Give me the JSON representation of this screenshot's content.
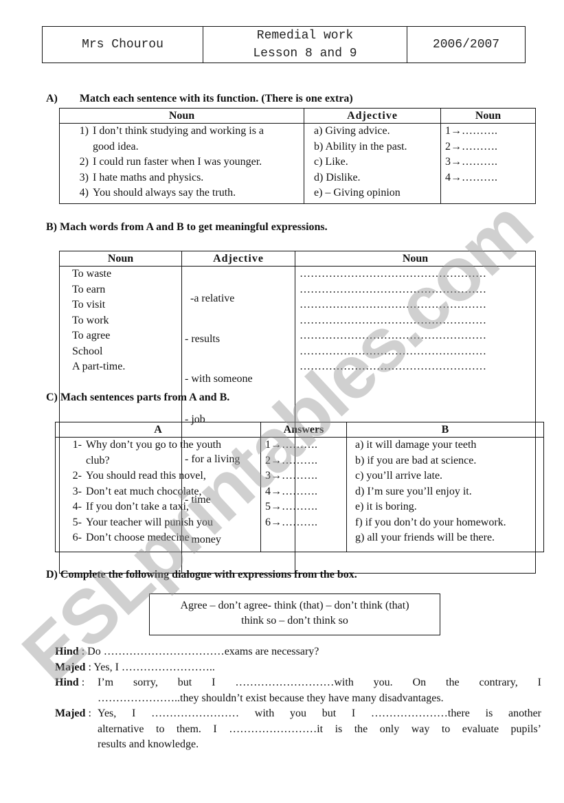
{
  "header": {
    "teacher": "Mrs Chourou",
    "title_line1": "Remedial work",
    "title_line2": "Lesson 8 and 9",
    "year": "2006/2007"
  },
  "watermark": "ESLprintables.com",
  "sectionA": {
    "label": "A)",
    "title": "Match each sentence with its function. (There is one extra)",
    "headers": [
      "Noun",
      "Adjective",
      "Noun"
    ],
    "sentences": [
      {
        "num": "1)",
        "line1": "I don’t think studying and working is a",
        "line2": "good idea."
      },
      {
        "num": "2)",
        "line1": "I could run faster when I was younger."
      },
      {
        "num": "3)",
        "line1": "I hate maths and physics."
      },
      {
        "num": "4)",
        "line1": "You should always say the truth."
      }
    ],
    "functions": [
      "a) Giving advice.",
      "b) Ability in the past.",
      "c) Like.",
      "d) Dislike.",
      "e) – Giving opinion"
    ],
    "answers": [
      "1→……….",
      "2→……….",
      "3→……….",
      "4→………."
    ]
  },
  "sectionB": {
    "title": "B) Mach words from A and B to get meaningful expressions.",
    "headers": [
      "Noun",
      "Adjective",
      "Noun"
    ],
    "colA": [
      "To waste",
      "To earn",
      "To visit",
      "To work",
      "To agree",
      "School",
      "A part-time."
    ],
    "colB": [
      "  -a relative",
      "- results",
      "- with someone",
      "- job",
      "- for a living",
      "- time",
      "- money"
    ],
    "answer_line": "……………………………………………"
  },
  "sectionC": {
    "title": "C) Mach sentences parts from A and B.",
    "headers": [
      "A",
      "Answers",
      "B"
    ],
    "colA": [
      {
        "num": "1-",
        "line1": "Why don’t you go to the youth",
        "line2": "club?"
      },
      {
        "num": "2-",
        "line1": "You should read this novel,"
      },
      {
        "num": "3-",
        "line1": "Don’t eat much chocolate,"
      },
      {
        "num": "4-",
        "line1": "If you don’t take a taxi,"
      },
      {
        "num": "5-",
        "line1": "Your teacher will punish you"
      },
      {
        "num": "6-",
        "line1": "Don’t choose medecine"
      }
    ],
    "answers": [
      "1→……….",
      "2→……….",
      "3→……….",
      "4→……….",
      "5→……….",
      "6→………."
    ],
    "colB": [
      "a) it will damage your teeth",
      "b) if you are bad at science.",
      "c) you’ll arrive late.",
      "d) I’m sure you’ll enjoy it.",
      "e) it is boring.",
      "f) if you don’t do your homework.",
      "g) all your friends will be there."
    ]
  },
  "sectionD": {
    "title": "D) Complete the following dialogue with expressions from the box.",
    "box_line1": "Agree – don’t agree- think (that) – don’t think (that)",
    "box_line2": "think so – don’t think so",
    "dialogue": [
      {
        "speaker": "Hind",
        "sep": " : ",
        "lines": [
          "Do ……………………………exams are necessary?"
        ]
      },
      {
        "speaker": "Majed",
        "sep": " : ",
        "lines": [
          "Yes, I …………………….."
        ]
      },
      {
        "speaker": "Hind",
        "sep": "  :  ",
        "lines": [
          "I’m sorry, but I ………………………with you. On the contrary, I",
          "…………………..they shouldn’t exist because they have many disadvantages."
        ]
      },
      {
        "speaker": "Majed",
        "sep": "  :  ",
        "lines": [
          "Yes, I …………………… with you but I …………………there is another",
          "alternative to them. I ……………………it is the only way to evaluate pupils’",
          "results and knowledge."
        ]
      }
    ]
  }
}
